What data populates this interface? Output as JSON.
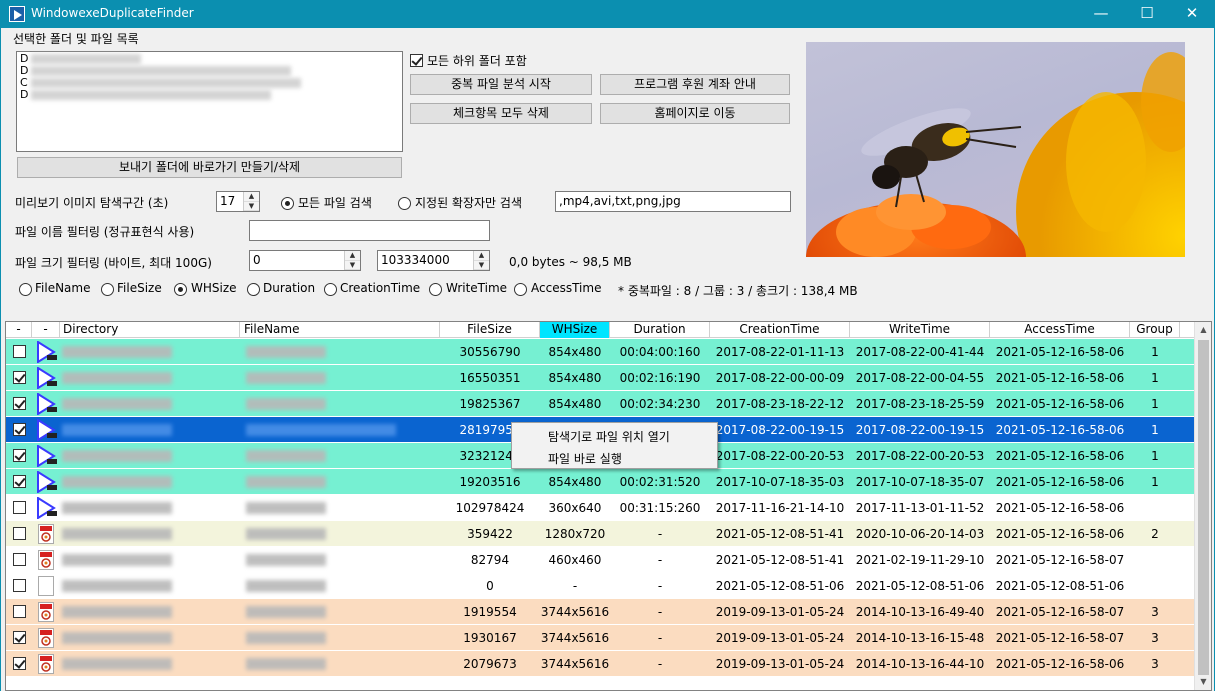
{
  "window": {
    "title": "WindowexeDuplicateFinder",
    "minimize": "—",
    "maximize": "☐",
    "close": "✕"
  },
  "folders": {
    "section_label": "선택한 폴더 및 파일 목록",
    "entries": [
      "D",
      "D",
      "C",
      "D"
    ],
    "include_subfolders": {
      "label": "모든 하위 폴더 포함",
      "checked": true
    },
    "shortcut_button": "보내기 폴더에 바로가기 만들기/삭제"
  },
  "actions": {
    "analyze": "중복 파일 분석 시작",
    "donate": "프로그램 후원 계좌 안내",
    "delete_checked": "체크항목 모두 삭제",
    "homepage": "홈페이지로 이동"
  },
  "preview": {
    "interval_label": "미리보기 이미지 탐색구간 (초)",
    "interval_value": "17",
    "all_files_label": "모든 파일 검색",
    "ext_only_label": "지정된 확장자만 검색",
    "extensions": ",mp4,avi,txt,png,jpg"
  },
  "name_filter": {
    "label": "파일 이름 필터링 (정규표현식 사용)",
    "value": ""
  },
  "size_filter": {
    "label": "파일 크기 필터링 (바이트, 최대 100G)",
    "min": "0",
    "max": "103334000",
    "range_text": "0,0 bytes ~ 98,5 MB"
  },
  "compare": {
    "options": [
      "FileName",
      "FileSize",
      "WHSize",
      "Duration",
      "CreationTime",
      "WriteTime",
      "AccessTime"
    ],
    "selected": "WHSize",
    "summary": "* 중복파일 : 8 / 그룹 : 3 / 총크기 : 138,4 MB"
  },
  "table": {
    "columns": [
      "-",
      "-",
      "Directory",
      "FileName",
      "FileSize",
      "WHSize",
      "Duration",
      "CreationTime",
      "WriteTime",
      "AccessTime",
      "Group"
    ],
    "rows": [
      {
        "checked": false,
        "icon": "video-file-icon",
        "size": "30556790",
        "wh": "854x480",
        "dur": "00:04:00:160",
        "ct": "2017-08-22-01-11-13",
        "wt": "2017-08-22-00-41-44",
        "at": "2021-05-12-16-58-06",
        "group": "1",
        "bg": "#76f0d2"
      },
      {
        "checked": true,
        "icon": "video-file-icon",
        "size": "16550351",
        "wh": "854x480",
        "dur": "00:02:16:190",
        "ct": "2017-08-22-00-00-09",
        "wt": "2017-08-22-00-04-55",
        "at": "2021-05-12-16-58-06",
        "group": "1",
        "bg": "#76f0d2"
      },
      {
        "checked": true,
        "icon": "video-file-icon",
        "size": "19825367",
        "wh": "854x480",
        "dur": "00:02:34:230",
        "ct": "2017-08-23-18-22-12",
        "wt": "2017-08-23-18-25-59",
        "at": "2021-05-12-16-58-06",
        "group": "1",
        "bg": "#76f0d2"
      },
      {
        "checked": true,
        "icon": "video-file-icon",
        "size": "28197958",
        "wh": "",
        "dur": "",
        "ct": "2017-08-22-00-19-15",
        "wt": "2017-08-22-00-19-15",
        "at": "2021-05-12-16-58-06",
        "group": "1",
        "bg": "#0a64d0",
        "selected": true
      },
      {
        "checked": true,
        "icon": "video-file-icon",
        "size": "32321248",
        "wh": "",
        "dur": "",
        "ct": "2017-08-22-00-20-53",
        "wt": "2017-08-22-00-20-53",
        "at": "2021-05-12-16-58-06",
        "group": "1",
        "bg": "#76f0d2"
      },
      {
        "checked": true,
        "icon": "video-file-icon",
        "size": "19203516",
        "wh": "854x480",
        "dur": "00:02:31:520",
        "ct": "2017-10-07-18-35-03",
        "wt": "2017-10-07-18-35-07",
        "at": "2021-05-12-16-58-06",
        "group": "1",
        "bg": "#76f0d2"
      },
      {
        "checked": false,
        "icon": "video-file-icon",
        "size": "102978424",
        "wh": "360x640",
        "dur": "00:31:15:260",
        "ct": "2017-11-16-21-14-10",
        "wt": "2017-11-13-01-11-52",
        "at": "2021-05-12-16-58-06",
        "group": "",
        "bg": "#ffffff"
      },
      {
        "checked": false,
        "icon": "image-file-icon",
        "size": "359422",
        "wh": "1280x720",
        "dur": "-",
        "ct": "2021-05-12-08-51-41",
        "wt": "2020-10-06-20-14-03",
        "at": "2021-05-12-16-58-06",
        "group": "2",
        "bg": "#f3f4dc"
      },
      {
        "checked": false,
        "icon": "image-file-icon",
        "size": "82794",
        "wh": "460x460",
        "dur": "-",
        "ct": "2021-05-12-08-51-41",
        "wt": "2021-02-19-11-29-10",
        "at": "2021-05-12-16-58-07",
        "group": "",
        "bg": "#ffffff"
      },
      {
        "checked": false,
        "icon": "blank-file-icon",
        "size": "0",
        "wh": "-",
        "dur": "-",
        "ct": "2021-05-12-08-51-06",
        "wt": "2021-05-12-08-51-06",
        "at": "2021-05-12-08-51-06",
        "group": "",
        "bg": "#ffffff"
      },
      {
        "checked": false,
        "icon": "image-file-icon",
        "size": "1919554",
        "wh": "3744x5616",
        "dur": "-",
        "ct": "2019-09-13-01-05-24",
        "wt": "2014-10-13-16-49-40",
        "at": "2021-05-12-16-58-07",
        "group": "3",
        "bg": "#fbdcc0"
      },
      {
        "checked": true,
        "icon": "image-file-icon",
        "size": "1930167",
        "wh": "3744x5616",
        "dur": "-",
        "ct": "2019-09-13-01-05-24",
        "wt": "2014-10-13-16-15-48",
        "at": "2021-05-12-16-58-07",
        "group": "3",
        "bg": "#fbdcc0"
      },
      {
        "checked": true,
        "icon": "image-file-icon",
        "size": "2079673",
        "wh": "3744x5616",
        "dur": "-",
        "ct": "2019-09-13-01-05-24",
        "wt": "2014-10-13-16-44-10",
        "at": "2021-05-12-16-58-06",
        "group": "3",
        "bg": "#fbdcc0"
      }
    ]
  },
  "context_menu": {
    "open_location": "탐색기로 파일 위치 열기",
    "run_file": "파일 바로 실행"
  },
  "colors": {
    "titlebar": "#0b8fb0",
    "group_teal": "#76f0d2",
    "group_orange": "#fbdcc0",
    "selected_row": "#0a64d0",
    "sorted_header": "#00e5ff"
  }
}
